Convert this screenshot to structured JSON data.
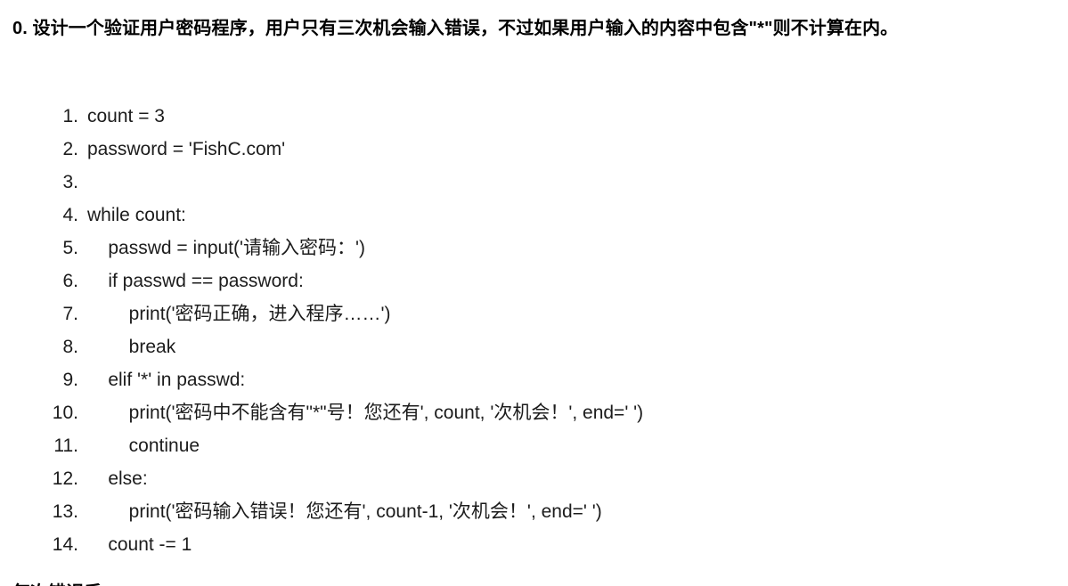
{
  "document": {
    "background_color": "#ffffff",
    "text_color": "#1c1c1c",
    "heading_color": "#000000"
  },
  "heading": {
    "text": "0. 设计一个验证用户密码程序，用户只有三次机会输入错误，不过如果用户输入的内容中包含\"*\"则不计算在内。"
  },
  "code": {
    "language": "python",
    "lines": [
      {
        "number": "1.",
        "text": "count = 3"
      },
      {
        "number": "2.",
        "text": "password = 'FishC.com'"
      },
      {
        "number": "3.",
        "text": ""
      },
      {
        "number": "4.",
        "text": "while count:"
      },
      {
        "number": "5.",
        "text": "    passwd = input('请输入密码：')"
      },
      {
        "number": "6.",
        "text": "    if passwd == password:"
      },
      {
        "number": "7.",
        "text": "        print('密码正确，进入程序……')"
      },
      {
        "number": "8.",
        "text": "        break"
      },
      {
        "number": "9.",
        "text": "    elif '*' in passwd:"
      },
      {
        "number": "10.",
        "text": "        print('密码中不能含有\"*\"号！您还有', count, '次机会！', end=' ')"
      },
      {
        "number": "11.",
        "text": "        continue"
      },
      {
        "number": "12.",
        "text": "    else:"
      },
      {
        "number": "13.",
        "text": "        print('密码输入错误！您还有', count-1, '次机会！', end=' ')"
      },
      {
        "number": "14.",
        "text": "    count -= 1"
      }
    ]
  },
  "clipped_trailing": {
    "text": "每次错误后"
  }
}
